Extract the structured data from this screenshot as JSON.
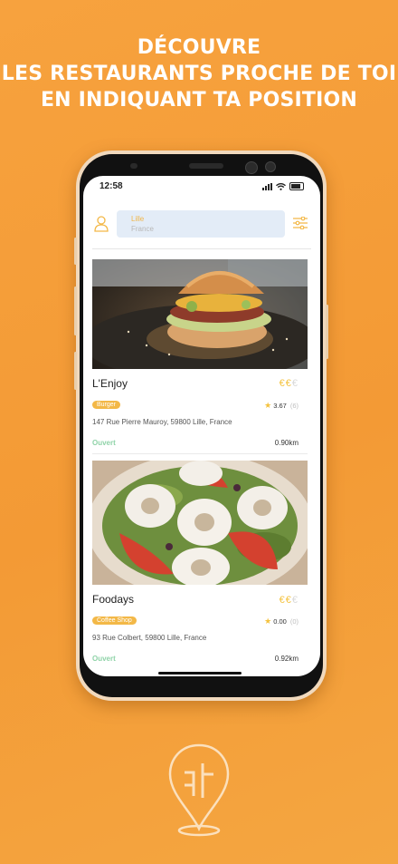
{
  "headline": {
    "line1": "DÉCOUVRE",
    "line2": "LES RESTAURANTS PROCHE DE TOI",
    "line3": "EN INDIQUANT TA POSITION"
  },
  "status_bar": {
    "time": "12:58"
  },
  "location": {
    "city": "Lille",
    "country": "France"
  },
  "restaurants": [
    {
      "name": "L'Enjoy",
      "price_symbol": "€",
      "price_level": 2,
      "price_max": 3,
      "category": "Burger",
      "rating": "3.67",
      "rating_count": "(6)",
      "address": "147 Rue Pierre Mauroy, 59800 Lille, France",
      "status": "Ouvert",
      "distance": "0.90km"
    },
    {
      "name": "Foodays",
      "price_symbol": "€",
      "price_level": 2,
      "price_max": 3,
      "category": "Coffee Shop",
      "rating": "0.00",
      "rating_count": "(0)",
      "address": "93 Rue Colbert, 59800 Lille, France",
      "status": "Ouvert",
      "distance": "0.92km"
    }
  ],
  "colors": {
    "background": "#f39a35",
    "accent": "#f3b847",
    "open": "#8fd3a8",
    "location_box": "#e3ecf7"
  }
}
